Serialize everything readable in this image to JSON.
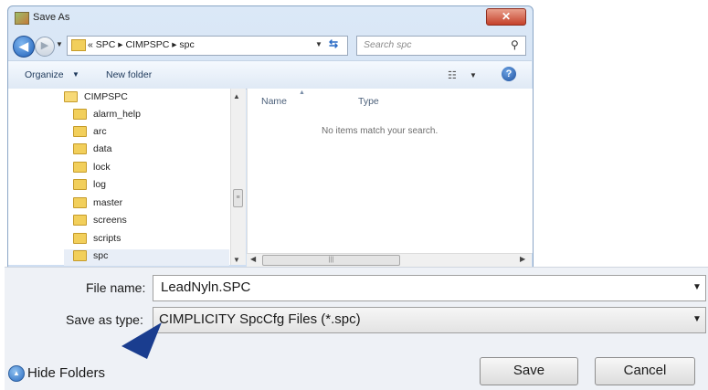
{
  "window": {
    "title": "Save As",
    "close_glyph": "✕",
    "icon": "save-as-icon"
  },
  "address_bar": {
    "path": "« SPC ▸ CIMPSPC ▸ spc",
    "search_placeholder": "Search spc"
  },
  "toolbar": {
    "organize_label": "Organize",
    "new_folder_label": "New folder",
    "views_icon": "views-icon",
    "help_glyph": "?"
  },
  "tree": {
    "parent": "CIMPSPC",
    "items": [
      "alarm_help",
      "arc",
      "data",
      "lock",
      "log",
      "master",
      "screens",
      "scripts",
      "spc"
    ],
    "selected": "spc"
  },
  "file_list": {
    "columns": [
      "Name",
      "Type"
    ],
    "empty_message": "No items match your search."
  },
  "form": {
    "file_name_label": "File name:",
    "file_name_value": "LeadNyln.SPC",
    "save_type_label": "Save as type:",
    "save_type_value": "CIMPLICITY SpcCfg Files (*.spc)"
  },
  "footer": {
    "hide_folders_label": "Hide Folders",
    "save_label": "Save",
    "cancel_label": "Cancel"
  },
  "colors": {
    "accent": "#1f5fb8",
    "pointer": "#1a3d8f"
  }
}
